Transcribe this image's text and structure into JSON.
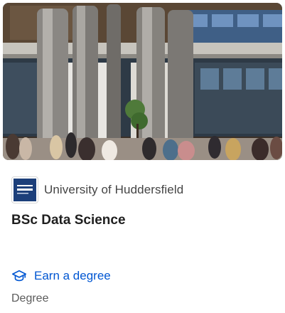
{
  "card": {
    "partner": {
      "name": "University of Huddersfield",
      "logo_text": "University of HUDDERSFIELD"
    },
    "title": "BSc Data Science",
    "credential_link": {
      "label": "Earn a degree",
      "icon": "graduation-cap-icon"
    },
    "product_type": "Degree"
  },
  "colors": {
    "link_blue": "#0056d2",
    "logo_navy": "#1c3f7a"
  }
}
